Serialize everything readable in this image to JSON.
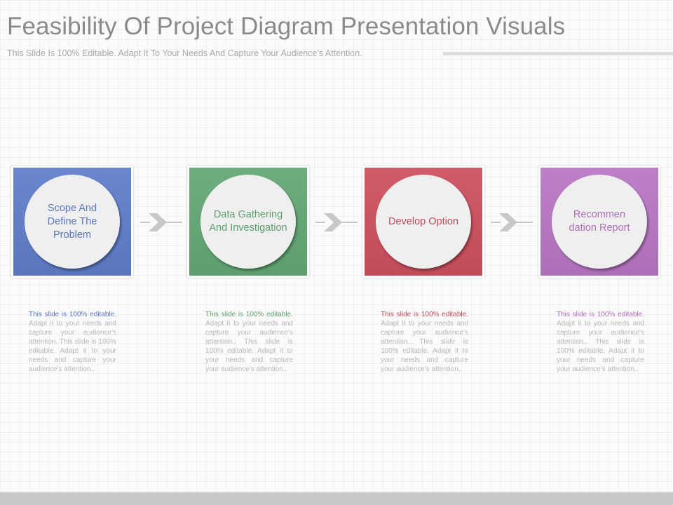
{
  "header": {
    "title": "Feasibility Of Project Diagram Presentation Visuals",
    "subtitle": "This Slide Is 100% Editable. Adapt It To Your Needs And Capture Your Audience's Attention."
  },
  "colors": {
    "step_1": "#5a76bf",
    "step_2": "#5e9e6e",
    "step_3": "#c24b5a",
    "step_4": "#ad70b8",
    "circle": "#efefef",
    "arrow": "#c8c8c8"
  },
  "steps": [
    {
      "label": "Scope And Define The Problem",
      "desc_lead": "This slide is 100% editable.",
      "desc_rest": " Adapt it to your needs and capture your audience's attention. This slide is 100% editable. Adapt it to your needs and capture your audience's attention.."
    },
    {
      "label": "Data Gathering And Investigation",
      "desc_lead": "This slide is 100% editable.",
      "desc_rest": " Adapt it to your needs and capture your audience's attention.. This slide is 100% editable. Adapt it to your needs and capture your audience's attention.."
    },
    {
      "label": "Develop Option",
      "desc_lead": "This slide is 100% editable.",
      "desc_rest": " Adapt it to your needs and capture your audience's attention.. This slide is 100% editable. Adapt it to your needs and capture your audience's attention.."
    },
    {
      "label": "Recommen dation Report",
      "desc_lead": "This slide is 100% editable.",
      "desc_rest": " Adapt it to your needs and capture your audience's attention.. This slide is 100% editable. Adapt it to your needs and capture your audience's attention.."
    }
  ]
}
